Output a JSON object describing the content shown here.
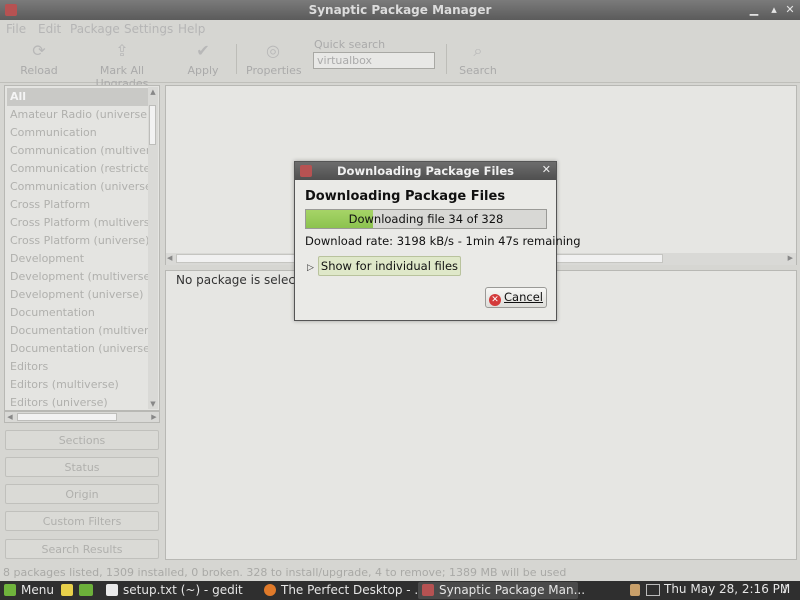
{
  "window": {
    "title": "Synaptic Package Manager"
  },
  "menu": [
    "File",
    "Edit",
    "Package",
    "Settings",
    "Help"
  ],
  "toolbar": {
    "reload": "Reload",
    "mark_all": "Mark All Upgrades",
    "apply": "Apply",
    "properties": "Properties",
    "quick_search_label": "Quick search",
    "quick_search_value": "virtualbox",
    "search": "Search"
  },
  "sidebar": {
    "categories": [
      "All",
      "Amateur Radio (universe)",
      "Communication",
      "Communication (multiverse)",
      "Communication (restricted)",
      "Communication (universe)",
      "Cross Platform",
      "Cross Platform (multiverse)",
      "Cross Platform (universe)",
      "Development",
      "Development (multiverse)",
      "Development (universe)",
      "Documentation",
      "Documentation (multiverse)",
      "Documentation (universe)",
      "Editors",
      "Editors (multiverse)",
      "Editors (universe)"
    ],
    "selected_index": 0
  },
  "filters": {
    "sections": "Sections",
    "status": "Status",
    "origin": "Origin",
    "custom": "Custom Filters",
    "search_results": "Search Results"
  },
  "details": {
    "text": "No package is selected"
  },
  "statusbar": {
    "text": "8 packages listed, 1309 installed, 0 broken. 328 to install/upgrade, 4 to remove; 1389 MB will be used"
  },
  "dialog": {
    "title": "Downloading Package Files",
    "heading": "Downloading Package Files",
    "progress_label": "Downloading file 34 of 328",
    "progress_fraction": 0.28,
    "rate": "Download rate: 3198 kB/s - 1min 47s remaining",
    "expander": "Show for individual files",
    "cancel": "Cancel"
  },
  "taskbar": {
    "menu": "Menu",
    "tasks": [
      "setup.txt (~) - gedit",
      "The Perfect Desktop - ...",
      "Synaptic Package Man..."
    ],
    "clock": "Thu May 28,  2:16 PM"
  },
  "colors": {
    "progress_fill": "#8cc34f",
    "taskbar": "#2f2f2f"
  }
}
